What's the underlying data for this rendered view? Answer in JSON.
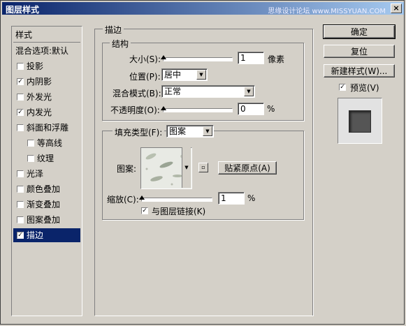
{
  "window": {
    "title": "图层样式",
    "watermark": "思缘设计论坛 www.MISSYUAN.COM",
    "close_label": "×"
  },
  "styles_panel": {
    "header": "样式",
    "blend_default": "混合选项:默认",
    "items": [
      {
        "label": "投影",
        "checked": false
      },
      {
        "label": "内阴影",
        "checked": true
      },
      {
        "label": "外发光",
        "checked": false
      },
      {
        "label": "内发光",
        "checked": true
      },
      {
        "label": "斜面和浮雕",
        "checked": false
      },
      {
        "label": "等高线",
        "checked": false
      },
      {
        "label": "纹理",
        "checked": false
      },
      {
        "label": "光泽",
        "checked": false
      },
      {
        "label": "颜色叠加",
        "checked": false
      },
      {
        "label": "渐变叠加",
        "checked": false
      },
      {
        "label": "图案叠加",
        "checked": false
      },
      {
        "label": "描边",
        "checked": true
      }
    ]
  },
  "stroke": {
    "section_title": "描边",
    "structure_title": "结构",
    "size_label": "大小(S):",
    "size_value": "1",
    "size_unit": "像素",
    "position_label": "位置(P):",
    "position_value": "居中",
    "blend_label": "混合模式(B):",
    "blend_value": "正常",
    "opacity_label": "不透明度(O):",
    "opacity_value": "0",
    "opacity_unit": "%",
    "fill_type_label": "填充类型(F):",
    "fill_type_value": "图案",
    "pattern_label": "图案:",
    "snap_button": "贴紧原点(A)",
    "scale_label": "缩放(C):",
    "scale_value": "1",
    "scale_unit": "%",
    "link_label": "与图层链接(K)",
    "link_checked": true
  },
  "buttons": {
    "ok": "确定",
    "reset": "复位",
    "new_style": "新建样式(W)...",
    "preview": "预览(V)",
    "preview_checked": true
  }
}
